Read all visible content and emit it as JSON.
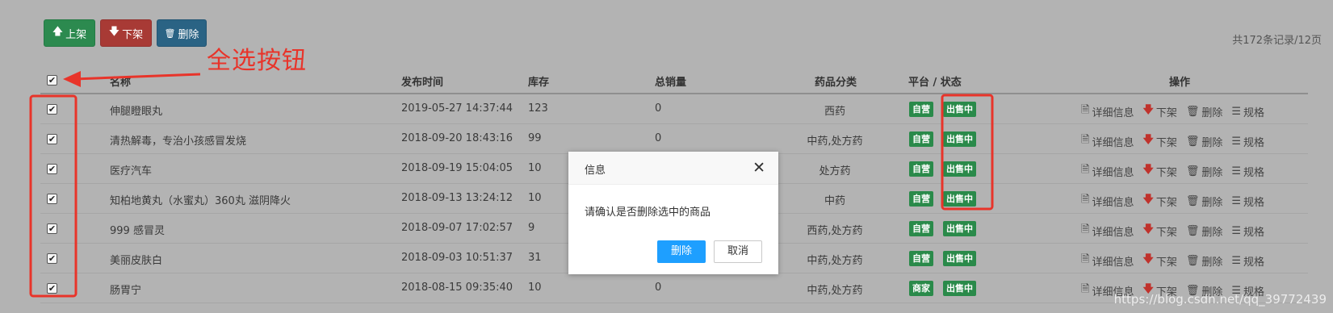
{
  "toolbar": {
    "up_label": "上架",
    "down_label": "下架",
    "delete_label": "删除",
    "up_icon": "arrow-up-icon",
    "down_icon": "arrow-down-icon",
    "delete_icon": "trash-icon"
  },
  "record_info": "共172条记录/12页",
  "annotation": {
    "text": "全选按钮",
    "color": "#e8342a"
  },
  "table": {
    "headers": {
      "name": "名称",
      "publish_time": "发布时间",
      "stock": "库存",
      "total_sales": "总销量",
      "category": "药品分类",
      "platform_status": "平台 / 状态",
      "actions": "操作"
    },
    "select_all_checked": true,
    "rows": [
      {
        "checked": true,
        "name": "伸腿瞪眼丸",
        "publish_time": "2019-05-27 14:37:44",
        "stock": "123",
        "sales": "0",
        "category": "西药",
        "platform": "自营",
        "status": "出售中"
      },
      {
        "checked": true,
        "name": "清热解毒，专治小孩感冒发烧",
        "publish_time": "2018-09-20 18:43:16",
        "stock": "99",
        "sales": "0",
        "category": "中药,处方药",
        "platform": "自营",
        "status": "出售中"
      },
      {
        "checked": true,
        "name": "医疗汽车",
        "publish_time": "2018-09-19 15:04:05",
        "stock": "10",
        "sales": "",
        "category": "处方药",
        "platform": "自营",
        "status": "出售中"
      },
      {
        "checked": true,
        "name": "知柏地黄丸（水蜜丸）360丸 滋阴降火",
        "publish_time": "2018-09-13 13:24:12",
        "stock": "10",
        "sales": "",
        "category": "中药",
        "platform": "自营",
        "status": "出售中"
      },
      {
        "checked": true,
        "name": "999 感冒灵",
        "publish_time": "2018-09-07 17:02:57",
        "stock": "9",
        "sales": "",
        "category": "西药,处方药",
        "platform": "自营",
        "status": "出售中"
      },
      {
        "checked": true,
        "name": "美丽皮肤白",
        "publish_time": "2018-09-03 10:51:37",
        "stock": "31",
        "sales": "",
        "category": "中药,处方药",
        "platform": "自营",
        "status": "出售中"
      },
      {
        "checked": true,
        "name": "肠胃宁",
        "publish_time": "2018-08-15 09:35:40",
        "stock": "10",
        "sales": "0",
        "category": "中药,处方药",
        "platform": "商家",
        "status": "出售中"
      }
    ],
    "row_actions": {
      "detail": "详细信息",
      "down": "下架",
      "delete": "删除",
      "spec": "规格"
    }
  },
  "dialog": {
    "title": "信息",
    "message": "请确认是否删除选中的商品",
    "confirm_label": "删除",
    "cancel_label": "取消",
    "close_icon": "close-icon"
  },
  "watermark": "https://blog.csdn.net/qq_39772439",
  "colors": {
    "overlay_bg": "#b3b3b3",
    "badge_green": "#2a8a4a",
    "btn_up": "#2c8a4f",
    "btn_down": "#a83a35",
    "btn_delete": "#2a6384",
    "confirm_blue": "#1e9fff",
    "annotation_red": "#e8342a"
  }
}
